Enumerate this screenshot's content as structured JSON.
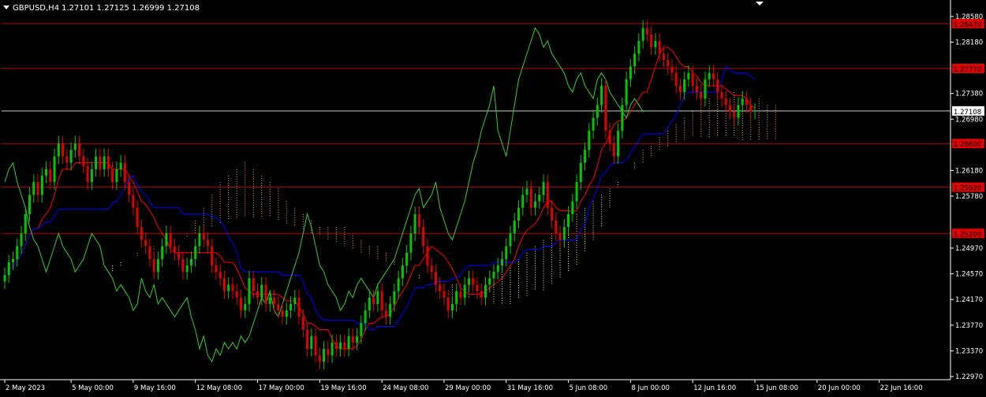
{
  "header": {
    "symbol_timeframe": "GBPUSD,H4",
    "ohlc_text": "1.27101 1.27125 1.26999 1.27108"
  },
  "colors": {
    "background": "#000000",
    "axis": "#ffffff",
    "candle_up": "#00c800",
    "candle_down": "#e00000",
    "tenkan": "#ff0000",
    "kijun": "#0000ff",
    "chikou": "#32cd32",
    "cloud_bull": "#f4a460",
    "cloud_bear": "#ffe4c4",
    "level_line": "#b00000",
    "level_label_bg": "#e00000",
    "price_line": "#c8c8c8"
  },
  "chart_data": {
    "type": "candlestick",
    "instrument": "GBPUSD",
    "timeframe": "H4",
    "indicator": "Ichimoku",
    "ylim": [
      1.2297,
      1.2864
    ],
    "price_ticks": [
      "1.28580",
      "1.28180",
      "1.27380",
      "1.26980",
      "1.26180",
      "1.25780",
      "1.24970",
      "1.24570",
      "1.24170",
      "1.23770",
      "1.23370",
      "1.22970"
    ],
    "time_labels": [
      "2 May 2023",
      "5 May 00:00",
      "9 May 16:00",
      "12 May 08:00",
      "17 May 00:00",
      "19 May 16:00",
      "24 May 08:00",
      "29 May 00:00",
      "31 May 16:00",
      "5 Jun 08:00",
      "8 Jun 00:00",
      "12 Jun 16:00",
      "15 Jun 08:00",
      "20 Jun 00:00",
      "22 Jun 16:00"
    ],
    "time_label_positions": [
      0,
      16,
      31,
      46,
      61,
      76,
      91,
      106,
      121,
      136,
      151,
      166,
      181,
      196,
      211
    ],
    "levels": [
      {
        "label": "1.28470",
        "value": 1.2847
      },
      {
        "label": "1.27770",
        "value": 1.2777
      },
      {
        "label": "1.26600",
        "value": 1.266
      },
      {
        "label": "1.25920",
        "value": 1.2592
      },
      {
        "label": "1.25200",
        "value": 1.252
      }
    ],
    "current_price": {
      "label": "1.27108",
      "value": 1.27108
    },
    "closes": [
      1.2455,
      1.2475,
      1.248,
      1.25,
      1.252,
      1.255,
      1.258,
      1.26,
      1.258,
      1.261,
      1.262,
      1.26,
      1.264,
      1.266,
      1.264,
      1.263,
      1.265,
      1.266,
      1.264,
      1.2625,
      1.26,
      1.262,
      1.264,
      1.262,
      1.264,
      1.262,
      1.26,
      1.262,
      1.263,
      1.26,
      1.258,
      1.256,
      1.253,
      1.251,
      1.25,
      1.248,
      1.246,
      1.248,
      1.25,
      1.252,
      1.25,
      1.249,
      1.248,
      1.246,
      1.247,
      1.248,
      1.25,
      1.252,
      1.251,
      1.25,
      1.247,
      1.246,
      1.245,
      1.243,
      1.244,
      1.243,
      1.242,
      1.24,
      1.241,
      1.245,
      1.243,
      1.242,
      1.244,
      1.241,
      1.242,
      1.241,
      1.24,
      1.239,
      1.24,
      1.241,
      1.242,
      1.239,
      1.237,
      1.234,
      1.236,
      1.233,
      1.232,
      1.234,
      1.233,
      1.235,
      1.234,
      1.235,
      1.234,
      1.236,
      1.235,
      1.236,
      1.238,
      1.24,
      1.242,
      1.241,
      1.243,
      1.24,
      1.239,
      1.241,
      1.243,
      1.245,
      1.247,
      1.249,
      1.252,
      1.255,
      1.253,
      1.25,
      1.247,
      1.246,
      1.244,
      1.243,
      1.242,
      1.24,
      1.241,
      1.243,
      1.242,
      1.244,
      1.245,
      1.244,
      1.243,
      1.242,
      1.244,
      1.245,
      1.246,
      1.247,
      1.248,
      1.25,
      1.252,
      1.254,
      1.256,
      1.258,
      1.259,
      1.256,
      1.257,
      1.258,
      1.26,
      1.256,
      1.254,
      1.252,
      1.251,
      1.253,
      1.255,
      1.257,
      1.26,
      1.263,
      1.265,
      1.268,
      1.27,
      1.272,
      1.275,
      1.268,
      1.266,
      1.264,
      1.268,
      1.272,
      1.276,
      1.278,
      1.28,
      1.282,
      1.284,
      1.283,
      1.281,
      1.282,
      1.28,
      1.279,
      1.278,
      1.277,
      1.275,
      1.274,
      1.276,
      1.277,
      1.275,
      1.274,
      1.273,
      1.276,
      1.277,
      1.276,
      1.274,
      1.273,
      1.272,
      1.271,
      1.27,
      1.272,
      1.273,
      1.272,
      1.271,
      1.2711
    ],
    "cloud_span_a": [
      1.246,
      1.247,
      1.248,
      1.249,
      1.249,
      1.25,
      1.251,
      1.251,
      1.251,
      1.252,
      1.254,
      1.256,
      1.258,
      1.26,
      1.261,
      1.262,
      1.263,
      1.262,
      1.261,
      1.26,
      1.259,
      1.257,
      1.256,
      1.255,
      1.254,
      1.253,
      1.253,
      1.253,
      1.253,
      1.252,
      1.251,
      1.25,
      1.25,
      1.249,
      1.248,
      1.247,
      1.246,
      1.245,
      1.245,
      1.244,
      1.243,
      1.242,
      1.242,
      1.242,
      1.242,
      1.242,
      1.241,
      1.241,
      1.241,
      1.242,
      1.242,
      1.243,
      1.243,
      1.244,
      1.245,
      1.246,
      1.247,
      1.249,
      1.251,
      1.253,
      1.256,
      1.259,
      1.261,
      1.263,
      1.265,
      1.266,
      1.267,
      1.268,
      1.269,
      1.27,
      1.271,
      1.272,
      1.273,
      1.274,
      1.274,
      1.274,
      1.274,
      1.273,
      1.273,
      1.272,
      1.272
    ],
    "cloud_span_b": [
      1.247,
      1.2475,
      1.248,
      1.2485,
      1.249,
      1.2495,
      1.25,
      1.2505,
      1.251,
      1.2515,
      1.252,
      1.2525,
      1.253,
      1.2535,
      1.254,
      1.2545,
      1.2545,
      1.2545,
      1.2545,
      1.2545,
      1.254,
      1.2535,
      1.253,
      1.2525,
      1.252,
      1.2515,
      1.251,
      1.2505,
      1.25,
      1.2495,
      1.249,
      1.2485,
      1.248,
      1.2475,
      1.247,
      1.2465,
      1.246,
      1.2455,
      1.245,
      1.2445,
      1.244,
      1.244,
      1.244,
      1.244,
      1.2445,
      1.245,
      1.2455,
      1.246,
      1.247,
      1.248,
      1.249,
      1.25,
      1.251,
      1.252,
      1.253,
      1.254,
      1.255,
      1.256,
      1.257,
      1.258,
      1.259,
      1.26,
      1.261,
      1.262,
      1.263,
      1.264,
      1.265,
      1.2655,
      1.266,
      1.2665,
      1.267,
      1.267,
      1.267,
      1.267,
      1.267,
      1.267,
      1.2665,
      1.2665,
      1.2665,
      1.2665,
      1.2665
    ],
    "cloud_start_index": 0
  }
}
